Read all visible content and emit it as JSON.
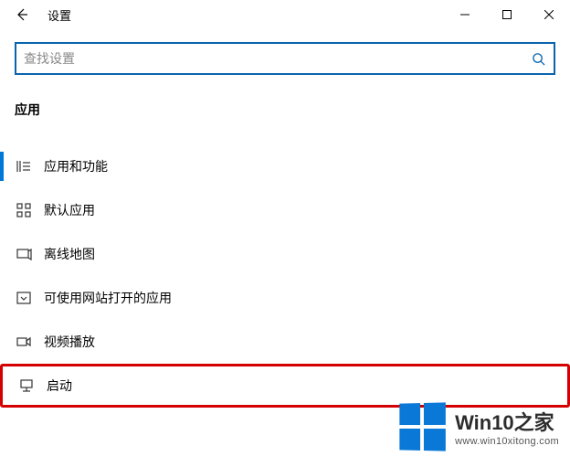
{
  "window": {
    "title": "设置"
  },
  "search": {
    "placeholder": "查找设置"
  },
  "section": {
    "header": "应用"
  },
  "nav": {
    "items": [
      {
        "label": "应用和功能"
      },
      {
        "label": "默认应用"
      },
      {
        "label": "离线地图"
      },
      {
        "label": "可使用网站打开的应用"
      },
      {
        "label": "视频播放"
      },
      {
        "label": "启动"
      }
    ]
  },
  "watermark": {
    "title": "Win10之家",
    "url": "www.win10xitong.com"
  }
}
